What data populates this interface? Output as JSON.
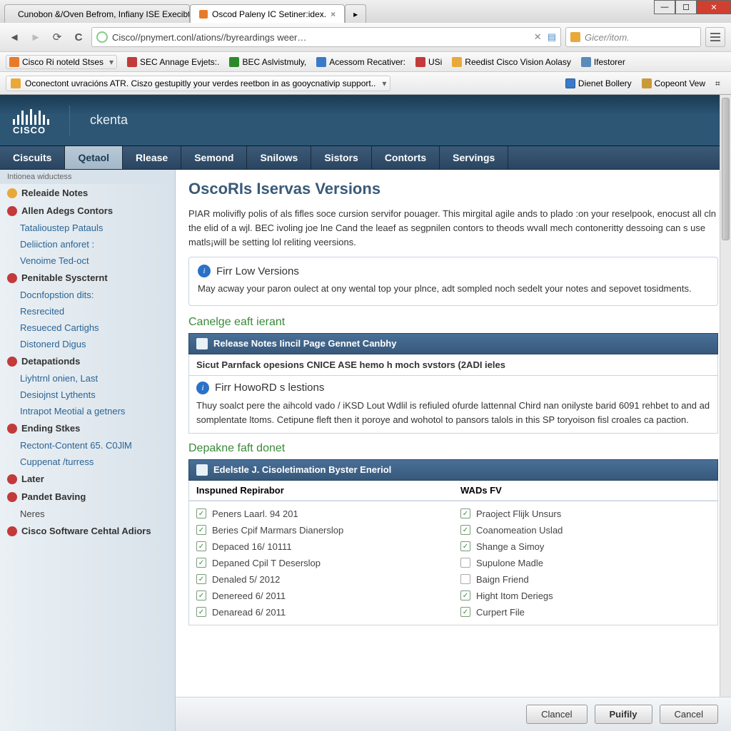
{
  "browser": {
    "tabs": [
      {
        "icon": "#3a9a3a",
        "label": "Cunobon &/Oven Befrom, Infiany ISE Execibters."
      },
      {
        "icon": "#e87a2a",
        "label": "Oscod Paleny IC Setiner:idex."
      }
    ],
    "url": "Cisco//pnymert.conl/ations//byreardings weer…",
    "search_placeholder": "Gicer/itom.",
    "bookmarks": [
      {
        "ico": "#e87a2a",
        "label": "Cisco Ri noteld Stses",
        "dropdown": true
      },
      {
        "ico": "#c23a3a",
        "label": "SEC Annage Evjets:."
      },
      {
        "ico": "#2a8a2a",
        "label": "BEC Aslvistmuly,"
      },
      {
        "ico": "#3a7ac8",
        "label": "Acessom Recativer:"
      },
      {
        "ico": "#c23a3a",
        "label": "USi"
      },
      {
        "ico": "#e8a83a",
        "label": "Reedist Cisco Vision Aolasy"
      },
      {
        "ico": "#5a8aba",
        "label": "Ifestorer"
      }
    ],
    "announce": "Oconectont uvracións ATR.  Ciszo gestupitly your verdes reetbon in as gooycnativip support..",
    "toolbar": [
      {
        "ico": "#3a7ac8",
        "label": "Dienet Bollery"
      },
      {
        "ico": "#c89a3a",
        "label": "Copeont Vew"
      },
      {
        "ico": "#888",
        "label": ""
      }
    ]
  },
  "cisco": {
    "brand": "ckenta"
  },
  "nav": [
    "Ciscuits",
    "Qetaol",
    "Rlease",
    "Semond",
    "Snilows",
    "Sistors",
    "Contorts",
    "Servings"
  ],
  "nav_active": 1,
  "side_crumb": "Intionea wiductess",
  "sidebar": [
    {
      "type": "sec",
      "bullet": "#e8a83a",
      "label": "Releaide Notes"
    },
    {
      "type": "sec",
      "bullet": "#c23a3a",
      "label": "Allen Adegs Contors"
    },
    {
      "type": "item",
      "label": "Tatalioustep Patauls"
    },
    {
      "type": "item",
      "label": "Deliiction anforet :"
    },
    {
      "type": "item",
      "label": "Venoime Ted-oct"
    },
    {
      "type": "sec",
      "bullet": "#c23a3a",
      "label": "Penitable Syscternt"
    },
    {
      "type": "item",
      "label": "Docnfopstion dits:"
    },
    {
      "type": "item",
      "label": "Resrecited"
    },
    {
      "type": "item",
      "label": "Resueced Cartighs"
    },
    {
      "type": "item",
      "label": "Distonerd Digus"
    },
    {
      "type": "sec",
      "bullet": "#c23a3a",
      "label": "Detapationds"
    },
    {
      "type": "item",
      "label": "Liyhtrnl onien, Last"
    },
    {
      "type": "item",
      "label": "Desiojnst Lythents"
    },
    {
      "type": "item",
      "label": "Intrapot Meotial a getners"
    },
    {
      "type": "sec",
      "bullet": "#c23a3a",
      "label": "Ending Stkes"
    },
    {
      "type": "item",
      "label": "Rectont-Content 65. C0JlM"
    },
    {
      "type": "item",
      "label": "Cuppenat /turress"
    },
    {
      "type": "sec",
      "bullet": "#c23a3a",
      "label": "Later"
    },
    {
      "type": "sec",
      "bullet": "#c23a3a",
      "label": "Pandet Baving"
    },
    {
      "type": "item",
      "plain": true,
      "label": "Neres"
    },
    {
      "type": "sec",
      "bullet": "#c23a3a",
      "label": "Cisco Software Cehtal Adiors"
    }
  ],
  "page": {
    "title": "OscoRIs Iservas Versions",
    "intro": "PIAR molivifly polis of als fifles soce cursion servifor pouager. This mirgital agile ands to plado :on your reselpook, enocust all cln the elid of a wjl. BEC ivoling joe lne Cand the leaef as segpnilen contors to theods wvall mech contoneritty dessoing can s use matls¡will be setting lol reliting veersions.",
    "box1_h": "Firr Low Versions",
    "box1_b": "May acway your paron oulect at ony wental top your plnce, adt sompled noch sedelt your notes and sepovet tosidments.",
    "sect1": "Canelge eaft ierant",
    "bar1": "Release Notes Iincil Page Gennet Canbhy",
    "sub1": "Sicut Parnfack opesions CNICE ASE hemo h moch svstors (2ADI ieles",
    "box2_h": "Firr HowoRD s lestions",
    "box2_b": "Thuy soalct pere the aihcold vado / iKSD Lout Wdlil is refiuled ofurde lattennal Chird nan onilyste barid 6091 rehbet to and ad somplentate ltoms. Cetipune fleft then it poroye and wohotol to pansors talols in this SP toryoison fisl croales ca paction.",
    "sect2": "Depakne faft donet",
    "bar2": "Edelstle J. Cisoletimation Byster Eneriol",
    "colA_h": "Inspuned Repirabor",
    "colB_h": "WADs FV",
    "colA": [
      {
        "c": true,
        "t": "Peners Laarl. 94 201"
      },
      {
        "c": true,
        "t": "Beries Cpif Marmars Dianerslop"
      },
      {
        "c": true,
        "t": "Depaced 16/ 10111"
      },
      {
        "c": true,
        "t": "Depaned Cpil T Deserslop"
      },
      {
        "c": true,
        "t": "Denaled 5/ 2012"
      },
      {
        "c": true,
        "t": "Denereed 6/ 2011"
      },
      {
        "c": true,
        "t": "Denaread 6/ 2011"
      }
    ],
    "colB": [
      {
        "c": true,
        "t": "Praoject Flijk Unsurs"
      },
      {
        "c": true,
        "t": "Coanomeation Uslad"
      },
      {
        "c": true,
        "t": "Shange a Simoy"
      },
      {
        "c": false,
        "t": "Supulone Madle"
      },
      {
        "c": false,
        "t": "Baign Friend"
      },
      {
        "c": true,
        "t": "Hight Itom Deriegs"
      },
      {
        "c": true,
        "t": "Curpert File"
      }
    ],
    "buttons": [
      "Clancel",
      "Puifily",
      "Cancel"
    ]
  }
}
